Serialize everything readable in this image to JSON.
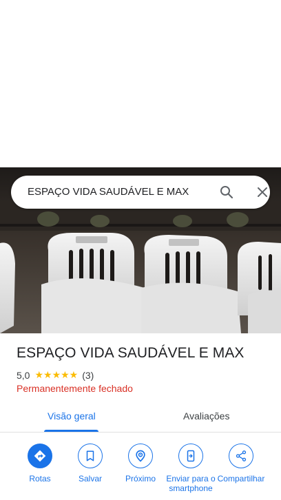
{
  "search": {
    "query": "ESPAÇO VIDA SAUDÁVEL E MAX",
    "search_icon": "search-icon",
    "close_icon": "close-icon"
  },
  "place": {
    "name": "ESPAÇO VIDA SAUDÁVEL E MAX",
    "rating": "5,0",
    "stars": "★★★★★",
    "review_count": "(3)",
    "status": "Permanentemente fechado"
  },
  "tabs": [
    {
      "label": "Visão geral",
      "active": true
    },
    {
      "label": "Avaliações",
      "active": false
    }
  ],
  "actions": [
    {
      "label": "Rotas",
      "icon": "directions-icon"
    },
    {
      "label": "Salvar",
      "icon": "bookmark-icon"
    },
    {
      "label": "Próximo",
      "icon": "nearby-icon"
    },
    {
      "label": "Enviar para o smartphone",
      "icon": "send-to-phone-icon"
    },
    {
      "label": "Compartilhar",
      "icon": "share-icon"
    }
  ],
  "colors": {
    "accent": "#1a73e8",
    "closed_status": "#d93025",
    "star": "#fbbc04"
  }
}
